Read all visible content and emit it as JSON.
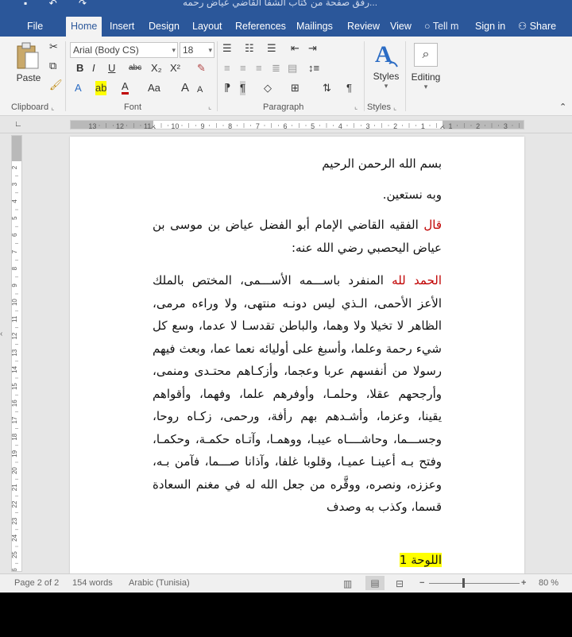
{
  "titlebar": {
    "title": "رفق صفحة من كتاب الشفا القاضي عياض رحمه..."
  },
  "tabs": [
    {
      "label": "File"
    },
    {
      "label": "Home"
    },
    {
      "label": "Insert"
    },
    {
      "label": "Design"
    },
    {
      "label": "Layout"
    },
    {
      "label": "References"
    },
    {
      "label": "Mailings"
    },
    {
      "label": "Review"
    },
    {
      "label": "View"
    }
  ],
  "tell_me": "Tell m",
  "sign_in": "Sign in",
  "share": "Share",
  "ribbon": {
    "paste": "Paste",
    "font_name": "Arial (Body CS)",
    "font_size": "18",
    "styles": "Styles",
    "editing": "Editing",
    "groups": {
      "clipboard": "Clipboard",
      "font": "Font",
      "paragraph": "Paragraph",
      "styles": "Styles"
    },
    "font_buttons": [
      "B",
      "I",
      "U",
      "abc",
      "X₂",
      "X²"
    ],
    "font_buttons2": [
      "A",
      "Aa",
      "A",
      "A"
    ]
  },
  "ruler": {
    "labels": [
      "13",
      "12",
      "11",
      "10",
      "9",
      "8",
      "7",
      "6",
      "5",
      "4",
      "3",
      "2",
      "1",
      "1",
      "2",
      "3"
    ]
  },
  "vruler": {
    "labels": [
      "2",
      "3",
      "4",
      "5",
      "6",
      "7",
      "8",
      "9",
      "10",
      "11",
      "12",
      "13",
      "14",
      "15",
      "16",
      "17",
      "18",
      "19",
      "20",
      "21",
      "22",
      "23",
      "24",
      "25",
      "26",
      "7"
    ]
  },
  "document": {
    "line1": "بسم الله الرحمن الرحيم",
    "line2": "وبه نستعين.",
    "para1_red": "قال",
    "para1_rest": " الفقيه القاضي الإمام أبو الفضل عياض بن موسى بن عياض اليحصبي رضي الله عنه:",
    "para2_red": "الحمد لله",
    "para2_rest": " المنفرد باســـمه الأســـمى، المختص بالملك الأعز الأحمى، الـذي ليس دونـه منتهى، ولا وراءه مرمى، الظاهر لا تخيلا ولا وهما، والباطن تقدسـا لا عدما، وسع كل شيء رحمة وعلما، وأسبغ على أوليائه نعما عما، وبعث فيهم رسولا من أنفسهم عربا وعجما، وأزكـاهم محتـدى ومنمى، وأرجحهم عقلا، وحلمـا، وأوفرهم علما، وفهما، وأقواهم يقينا، وعزما، وأشـدهم بهم رأفة، ورحمى، زكـاه روحا، وجســـما، وحاشــــاه عيبـا، ووهمـا، وآتـاه حكمـة، وحكمـا، وفتح بـه أعينـا عميـا، وقلوبا غلفا، وآذانا صـــما، فآمن بـه، وعززه، ونصره، ووقَّره من جعل الله له في مغنم السعادة قسما، وكذب به وصدف",
    "heading": "اللوحة 1"
  },
  "status": {
    "page": "Page 2 of 2",
    "words": "154 words",
    "language": "Arabic (Tunisia)",
    "zoom": "80 %"
  },
  "colors": {
    "ribbon_blue": "#2b579a",
    "red_text": "#c00000",
    "highlight": "#ffff00"
  }
}
